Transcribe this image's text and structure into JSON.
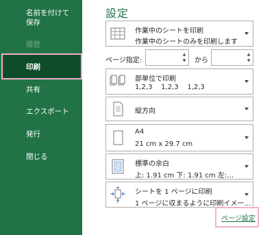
{
  "sidebar": {
    "save_as_named": "名前を付けて保存",
    "history": "履歴",
    "print": "印刷",
    "share": "共有",
    "export": "エクスポート",
    "publish": "発行",
    "close": "閉じる"
  },
  "main": {
    "title": "設定",
    "print_what": {
      "line1": "作業中のシートを印刷",
      "line2": "作業中のシートのみを印刷します"
    },
    "pages_label": "ページ指定:",
    "pages_from": "",
    "pages_to_label": "から",
    "pages_to": "",
    "collation": {
      "line1": "部単位で印刷",
      "line2": "1,2,3    1,2,3    1,2,3"
    },
    "orientation": {
      "line1": "縦方向"
    },
    "paper_size": {
      "line1": "A4",
      "line2": "21 cm x 29.7 cm"
    },
    "margins": {
      "line1": "標準の余白",
      "line2": "上: 1.91 cm 下: 1.91 cm 左:…"
    },
    "scaling": {
      "line1": "シートを 1 ページに印刷",
      "line2": "1 ページに収まるように印刷イメー…"
    },
    "page_setup_link": "ページ設定"
  },
  "colors": {
    "accent": "#217346",
    "highlight": "#f3b0c9"
  }
}
